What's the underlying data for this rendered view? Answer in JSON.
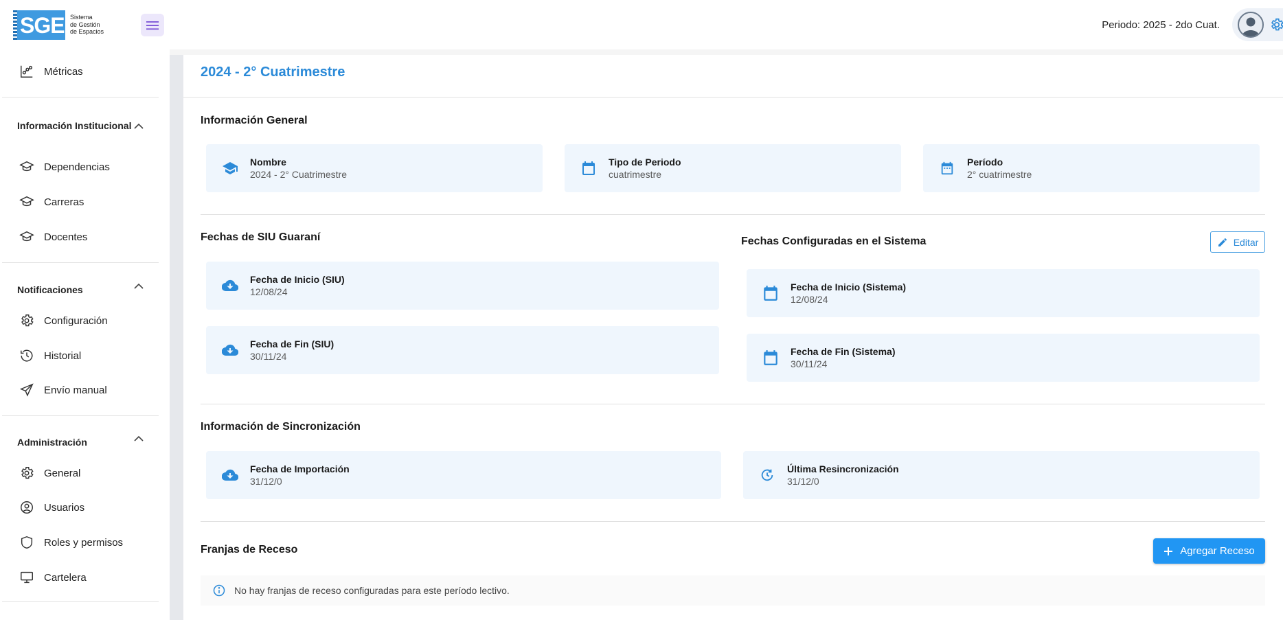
{
  "app": {
    "logo_text": "SGE",
    "logo_subtitle_1": "Sistema",
    "logo_subtitle_2": "de Gestión",
    "logo_subtitle_3": "de Espacios"
  },
  "header": {
    "period_label": "Periodo: 2025 - 2do Cuat."
  },
  "sidebar": {
    "metricas": "Métricas",
    "section_institucional": "Información Institucional",
    "dependencias": "Dependencias",
    "carreras": "Carreras",
    "docentes": "Docentes",
    "section_notificaciones": "Notificaciones",
    "configuracion": "Configuración",
    "historial": "Historial",
    "envio_manual": "Envío manual",
    "section_administracion": "Administración",
    "general": "General",
    "usuarios": "Usuarios",
    "roles": "Roles y permisos",
    "cartelera": "Cartelera"
  },
  "main": {
    "title": "2024 - 2° Cuatrimestre",
    "info_general": {
      "title": "Información General",
      "nombre_label": "Nombre",
      "nombre_value": "2024 - 2° Cuatrimestre",
      "tipo_label": "Tipo de Periodo",
      "tipo_value": "cuatrimestre",
      "periodo_label": "Período",
      "periodo_value": "2° cuatrimestre"
    },
    "siu": {
      "title": "Fechas de SIU Guaraní",
      "inicio_label": "Fecha de Inicio (SIU)",
      "inicio_value": "12/08/24",
      "fin_label": "Fecha de Fin (SIU)",
      "fin_value": "30/11/24"
    },
    "sistema": {
      "title": "Fechas Configuradas en el Sistema",
      "edit_label": "Editar",
      "inicio_label": "Fecha de Inicio (Sistema)",
      "inicio_value": "12/08/24",
      "fin_label": "Fecha de Fin (Sistema)",
      "fin_value": "30/11/24"
    },
    "sync": {
      "title": "Información de Sincronización",
      "importacion_label": "Fecha de Importación",
      "importacion_value": "31/12/0",
      "resync_label": "Última Resincronización",
      "resync_value": "31/12/0"
    },
    "receso": {
      "title": "Franjas de Receso",
      "add_label": "Agregar Receso",
      "empty_message": "No hay franjas de receso configuradas para este período lectivo."
    }
  },
  "colors": {
    "accent": "#2196f3",
    "title_blue": "#2b8ad8",
    "card_bg": "#eff6fd"
  }
}
